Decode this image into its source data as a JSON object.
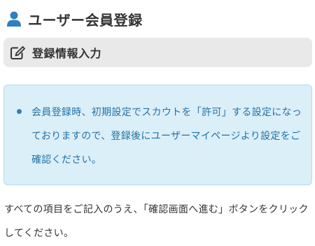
{
  "header": {
    "icon": "user-icon",
    "title": "ユーザー会員登録"
  },
  "section": {
    "icon": "edit-icon",
    "title": "登録情報入力"
  },
  "notice": {
    "items": [
      "会員登録時、初期設定でスカウトを「許可」する設定になっておりますので、登録後にユーザーマイページより設定をご確認ください。"
    ],
    "text_color": "#2472a6",
    "background": "#dbeff8"
  },
  "instructions": "すべての項目をご記入のうえ、「確認画面へ進む」ボタンをクリックしてください。"
}
